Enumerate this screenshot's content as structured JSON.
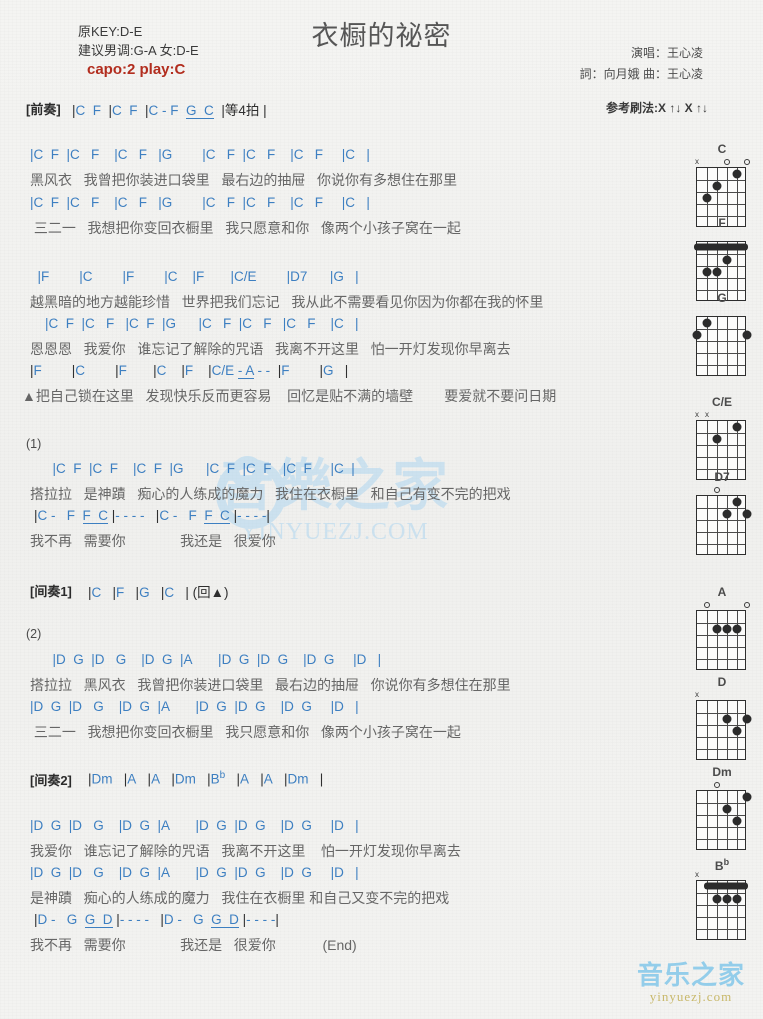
{
  "header": {
    "orig_key": "原KEY:D-E",
    "suggest_key": "建议男调:G-A 女:D-E",
    "capo": "capo:2 play:C",
    "capo_color": "#b22d1e",
    "title": "衣橱的祕密",
    "singer": "演唱：王心凌",
    "writer": "詞：向月娥   曲：王心凌",
    "strum": "参考刷法:X ↑↓ X ↑↓"
  },
  "intro": {
    "tag": "[前奏]",
    "chords": "|C  F  |C  F  |C - F  G  C  |等4拍 |"
  },
  "sections": [
    {
      "name": "verse-1",
      "lines": [
        {
          "type": "chords",
          "text": "|C  F  |C   F    |C   F   |G        |C   F  |C   F    |C   F     |C   |"
        },
        {
          "type": "lyrics",
          "text": "黑风衣   我曾把你装进口袋里   最右边的抽屉   你说你有多想住在那里"
        },
        {
          "type": "chords",
          "text": "|C  F  |C   F    |C   F   |G        |C   F  |C   F    |C   F     |C   |"
        },
        {
          "type": "lyrics",
          "text": " 三二一   我想把你变回衣橱里   我只愿意和你   像两个小孩子窝在一起"
        }
      ]
    },
    {
      "name": "pre-chorus",
      "lines": [
        {
          "type": "chords",
          "text": "  |F        |C        |F        |C    |F       |C/E        |D7      |G   |"
        },
        {
          "type": "lyrics",
          "text": "越黑暗的地方越能珍惜   世界把我们忘记   我从此不需要看见你因为你都在我的怀里"
        },
        {
          "type": "chords",
          "text": "    |C  F  |C   F   |C  F  |G      |C   F  |C   F   |C   F    |C   |"
        },
        {
          "type": "lyrics",
          "text": "恩恩恩   我爱你   谁忘记了解除的咒语   我离不开这里   怕一开灯发现你早离去"
        },
        {
          "type": "chords",
          "text": " |F        |C        |F       |C    |F    |C/E  - A  - -  |F        |G   |"
        },
        {
          "type": "lyrics",
          "text": "▲把自己锁在这里   发现快乐反而更容易    回忆是贴不满的墙壁        要爱就不要问日期"
        }
      ]
    },
    {
      "name": "chorus-1",
      "number": "(1)",
      "lines": [
        {
          "type": "chords",
          "text": "      |C  F  |C  F    |C  F  |G      |C  F  |C  F   |C  F     |C  |"
        },
        {
          "type": "lyrics",
          "text": "搭拉拉   是神蹟   痴心的人练成的魔力   我住在衣橱里   和自己有变不完的把戏"
        },
        {
          "type": "chords",
          "text": " |C -   F  F  C  |- - - -   |C -   F  F  C  |- - - -|"
        },
        {
          "type": "lyrics",
          "text": "我不再   需要你              我还是   很爱你"
        }
      ]
    },
    {
      "name": "interlude-1",
      "tag": "[间奏1]",
      "chords": "|C   |F   |G   |C   | (回▲)"
    },
    {
      "name": "verse-2",
      "number": "(2)",
      "lines": [
        {
          "type": "chords",
          "text": "      |D  G  |D   G    |D  G  |A       |D  G  |D  G    |D  G     |D   |"
        },
        {
          "type": "lyrics",
          "text": "搭拉拉   黑风衣   我曾把你装进口袋里   最右边的抽屉   你说你有多想住在那里"
        },
        {
          "type": "chords",
          "text": "|D  G  |D   G    |D  G  |A       |D  G  |D  G    |D  G     |D   |"
        },
        {
          "type": "lyrics",
          "text": " 三二一   我想把你变回衣橱里   我只愿意和你   像两个小孩子窝在一起"
        }
      ]
    },
    {
      "name": "interlude-2",
      "tag": "[间奏2]",
      "chords": "|Dm   |A   |A   |Dm   |Bb   |A   |A   |Dm   |"
    },
    {
      "name": "chorus-2",
      "lines": [
        {
          "type": "chords",
          "text": "|D  G  |D   G    |D  G  |A       |D  G  |D  G    |D  G     |D   |"
        },
        {
          "type": "lyrics",
          "text": "我爱你   谁忘记了解除的咒语   我离不开这里    怕一开灯发现你早离去"
        },
        {
          "type": "chords",
          "text": "|D  G  |D   G    |D  G  |A       |D  G  |D  G    |D  G     |D   |"
        },
        {
          "type": "lyrics",
          "text": "是神蹟   痴心的人练成的魔力   我住在衣橱里 和自己又变不完的把戏"
        },
        {
          "type": "chords",
          "text": "  |D -   G  G  D  |- - - -   |D -   G  G  D  |- - - -|"
        },
        {
          "type": "lyrics",
          "text": "我不再   需要你              我还是   很爱你            (End)"
        }
      ]
    }
  ],
  "end_marker": "(End)",
  "chord_diagrams": [
    {
      "name": "C",
      "markers": [
        {
          "type": "x",
          "string": 6
        },
        {
          "type": "o",
          "string": 3
        },
        {
          "type": "o",
          "string": 1
        }
      ],
      "dots": [
        {
          "string": 5,
          "fret": 3
        },
        {
          "string": 4,
          "fret": 2
        },
        {
          "string": 2,
          "fret": 1
        }
      ],
      "barre": null
    },
    {
      "name": "F",
      "markers": [],
      "dots": [
        {
          "string": 5,
          "fret": 3
        },
        {
          "string": 4,
          "fret": 3
        },
        {
          "string": 3,
          "fret": 2
        }
      ],
      "barre": {
        "fret": 1,
        "from_string": 6,
        "to_string": 1
      }
    },
    {
      "name": "G",
      "markers": [],
      "dots": [
        {
          "string": 6,
          "fret": 2
        },
        {
          "string": 5,
          "fret": 1
        },
        {
          "string": 1,
          "fret": 2
        }
      ],
      "barre": null
    },
    {
      "name": "C/E",
      "markers": [
        {
          "type": "x",
          "string": 6
        },
        {
          "type": "x",
          "string": 5
        }
      ],
      "dots": [
        {
          "string": 4,
          "fret": 2
        },
        {
          "string": 2,
          "fret": 1
        }
      ],
      "barre": null
    },
    {
      "name": "D7",
      "markers": [
        {
          "type": "o",
          "string": 4
        }
      ],
      "dots": [
        {
          "string": 3,
          "fret": 2
        },
        {
          "string": 2,
          "fret": 1
        },
        {
          "string": 1,
          "fret": 2
        }
      ],
      "barre": null
    },
    {
      "name": "A",
      "markers": [
        {
          "type": "o",
          "string": 5
        },
        {
          "type": "o",
          "string": 1
        }
      ],
      "dots": [
        {
          "string": 4,
          "fret": 2
        },
        {
          "string": 3,
          "fret": 2
        },
        {
          "string": 2,
          "fret": 2
        }
      ],
      "barre": null
    },
    {
      "name": "D",
      "markers": [
        {
          "type": "x",
          "string": 6
        }
      ],
      "dots": [
        {
          "string": 3,
          "fret": 2
        },
        {
          "string": 2,
          "fret": 3
        },
        {
          "string": 1,
          "fret": 2
        }
      ],
      "barre": null
    },
    {
      "name": "Dm",
      "markers": [
        {
          "type": "o",
          "string": 4
        }
      ],
      "dots": [
        {
          "string": 3,
          "fret": 2
        },
        {
          "string": 2,
          "fret": 3
        },
        {
          "string": 1,
          "fret": 1
        }
      ],
      "barre": null
    },
    {
      "name": "Bb",
      "name_base": "B",
      "name_sup": "b",
      "markers": [
        {
          "type": "x",
          "string": 6
        }
      ],
      "dots": [
        {
          "string": 4,
          "fret": 2
        },
        {
          "string": 3,
          "fret": 2
        },
        {
          "string": 2,
          "fret": 2
        }
      ],
      "barre": {
        "fret": 1,
        "from_string": 5,
        "to_string": 1
      }
    }
  ],
  "watermark": {
    "logo": "音樂之家",
    "url": "YINYUEZJ.COM",
    "corner_top": "音乐之家",
    "corner_bottom": "yinyuezj.com"
  }
}
